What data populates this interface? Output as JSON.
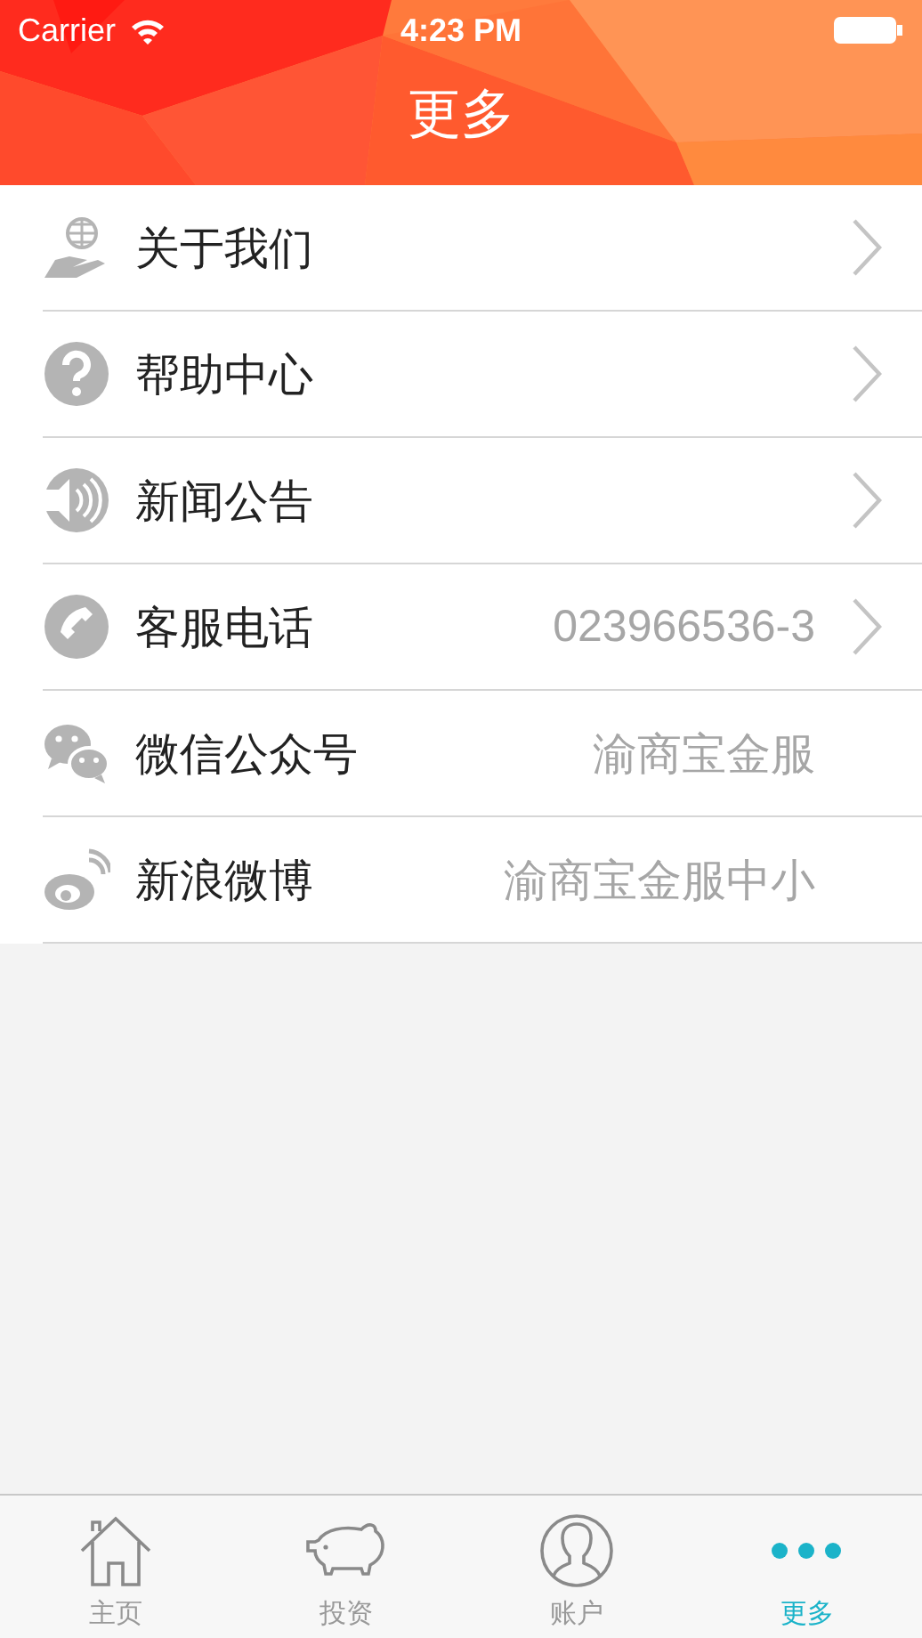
{
  "status_bar": {
    "carrier": "Carrier",
    "time": "4:23 PM"
  },
  "header": {
    "title": "更多"
  },
  "rows": [
    {
      "label": "关于我们",
      "has_chevron": true
    },
    {
      "label": "帮助中心",
      "has_chevron": true
    },
    {
      "label": "新闻公告",
      "has_chevron": true
    },
    {
      "label": "客服电话",
      "value": "023966536-3",
      "has_chevron": true
    },
    {
      "label": "微信公众号",
      "value": "渝商宝金服",
      "has_chevron": false
    },
    {
      "label": "新浪微博",
      "value": "渝商宝金服中小",
      "has_chevron": false
    }
  ],
  "tab_bar": [
    {
      "label": "主页",
      "selected": false
    },
    {
      "label": "投资",
      "selected": false
    },
    {
      "label": "账户",
      "selected": false
    },
    {
      "label": "更多",
      "selected": true
    }
  ]
}
